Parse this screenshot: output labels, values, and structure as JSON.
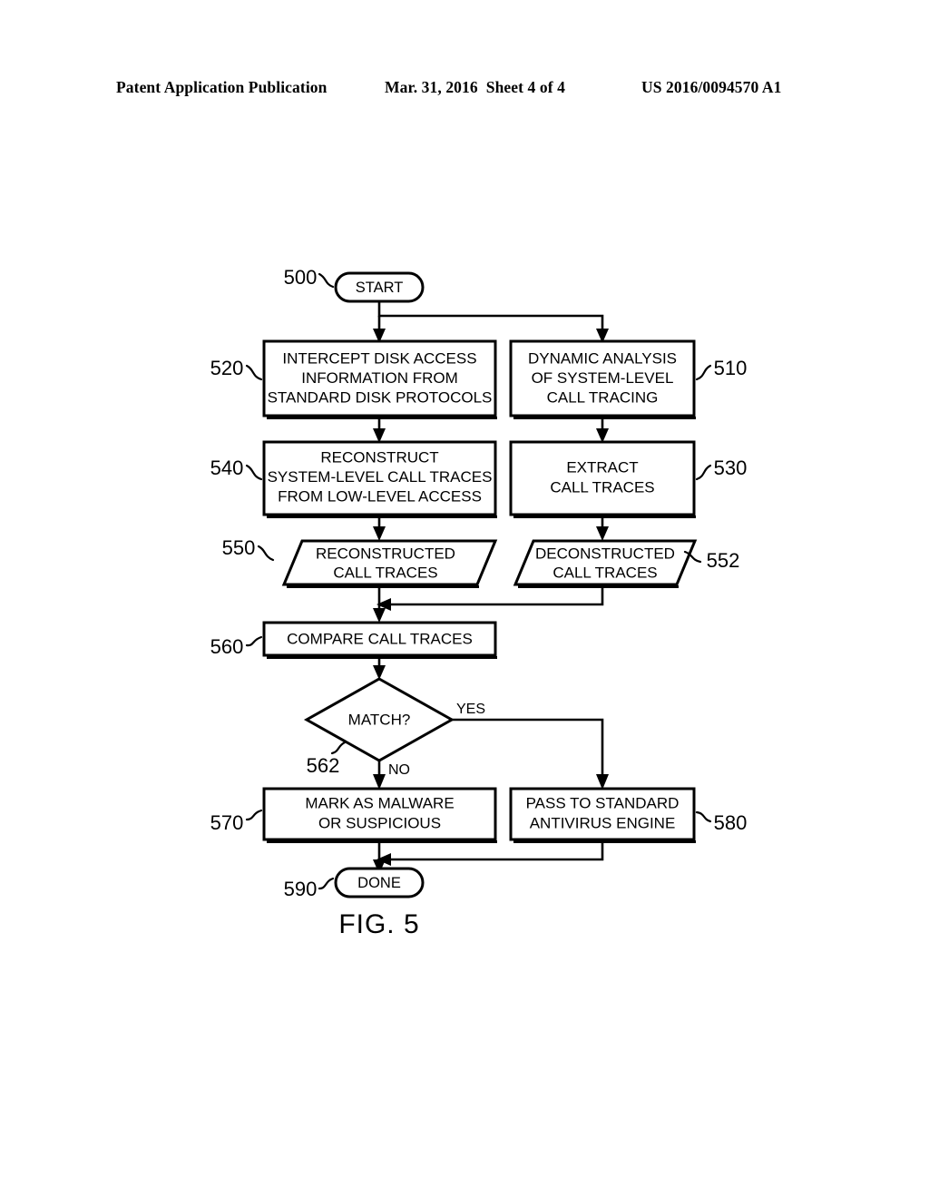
{
  "header": {
    "publication": "Patent Application Publication",
    "date": "Mar. 31, 2016",
    "sheet": "Sheet 4 of 4",
    "patent_number": "US 2016/0094570 A1"
  },
  "figure": {
    "label": "FIG. 5",
    "nodes": {
      "start": {
        "ref": "500",
        "text": "START"
      },
      "n520": {
        "ref": "520",
        "line1": "INTERCEPT DISK ACCESS",
        "line2": "INFORMATION FROM",
        "line3": "STANDARD DISK PROTOCOLS"
      },
      "n510": {
        "ref": "510",
        "line1": "DYNAMIC ANALYSIS",
        "line2": "OF SYSTEM-LEVEL",
        "line3": "CALL TRACING"
      },
      "n540": {
        "ref": "540",
        "line1": "RECONSTRUCT",
        "line2": "SYSTEM-LEVEL CALL TRACES",
        "line3": "FROM LOW-LEVEL ACCESS"
      },
      "n530": {
        "ref": "530",
        "line1": "EXTRACT",
        "line2": "CALL TRACES"
      },
      "n550": {
        "ref": "550",
        "line1": "RECONSTRUCTED",
        "line2": "CALL TRACES"
      },
      "n552": {
        "ref": "552",
        "line1": "DECONSTRUCTED",
        "line2": "CALL TRACES"
      },
      "n560": {
        "ref": "560",
        "line1": "COMPARE CALL TRACES"
      },
      "n562": {
        "ref": "562",
        "text": "MATCH?"
      },
      "n570": {
        "ref": "570",
        "line1": "MARK AS MALWARE",
        "line2": "OR SUSPICIOUS"
      },
      "n580": {
        "ref": "580",
        "line1": "PASS TO STANDARD",
        "line2": "ANTIVIRUS ENGINE"
      },
      "done": {
        "ref": "590",
        "text": "DONE"
      }
    },
    "branches": {
      "yes": "YES",
      "no": "NO"
    },
    "colors": {
      "ink": "#000000",
      "paper": "#ffffff"
    }
  }
}
